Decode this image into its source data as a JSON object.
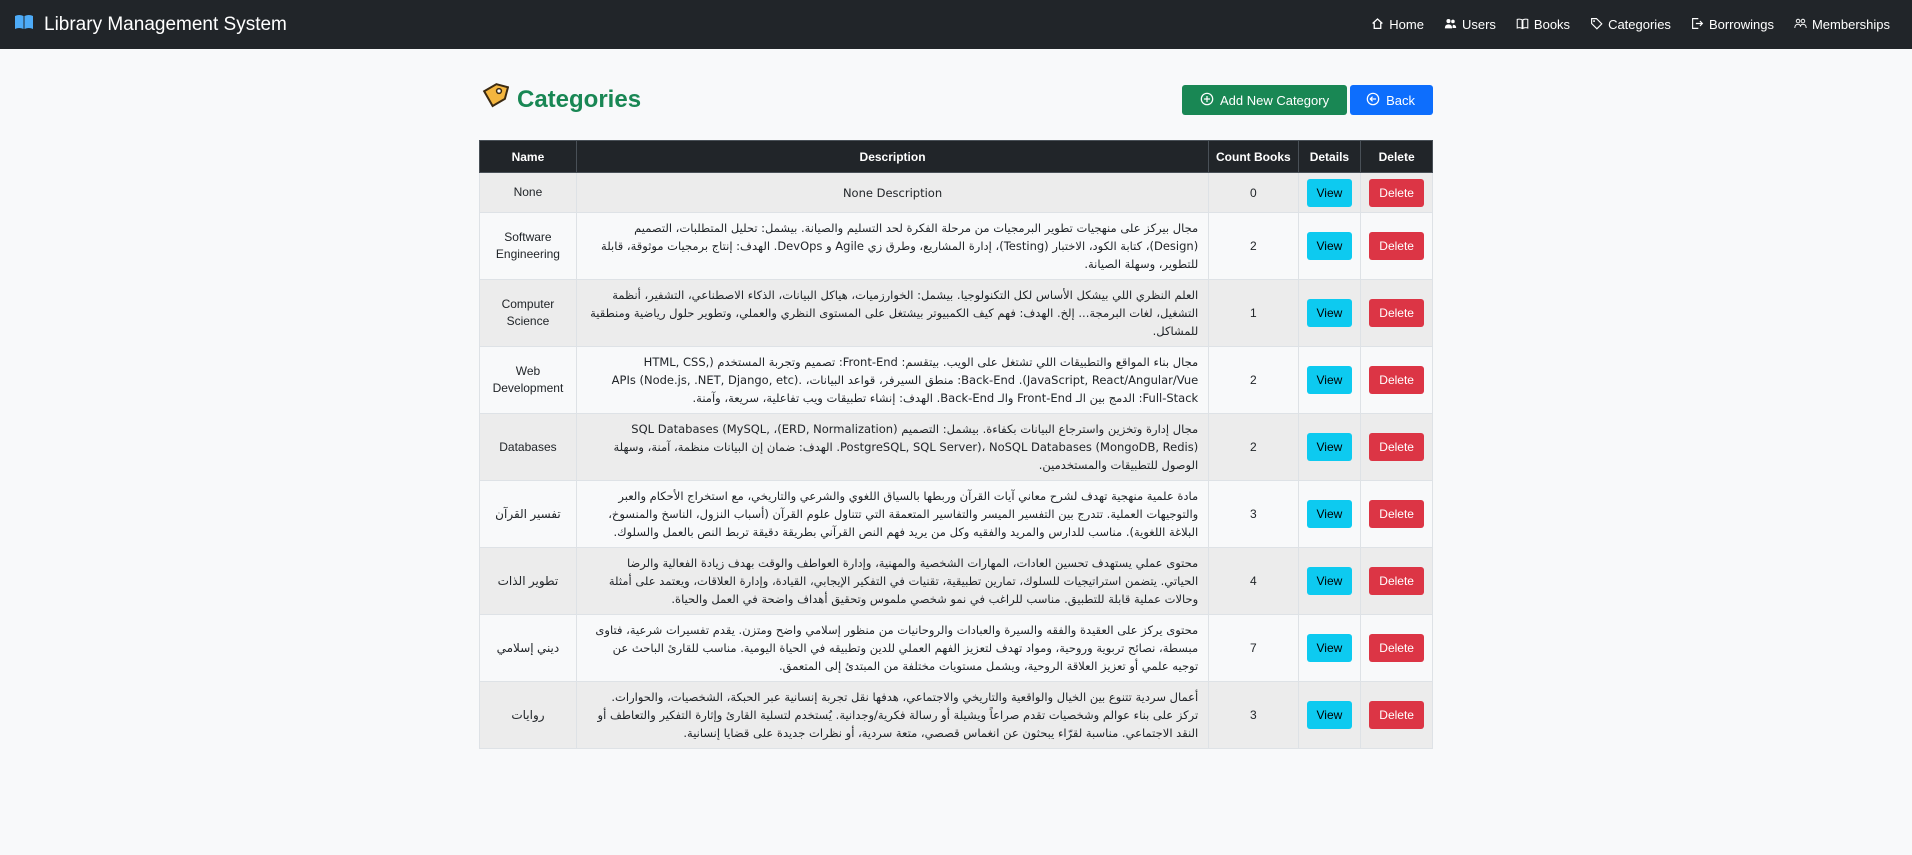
{
  "nav": {
    "brand": "Library Management System",
    "links": [
      {
        "label": "Home",
        "icon": "house-icon"
      },
      {
        "label": "Users",
        "icon": "users-icon"
      },
      {
        "label": "Books",
        "icon": "book-icon"
      },
      {
        "label": "Categories",
        "icon": "tag-icon"
      },
      {
        "label": "Borrowings",
        "icon": "arrow-out-icon"
      },
      {
        "label": "Memberships",
        "icon": "people-icon"
      }
    ]
  },
  "page": {
    "title": "Categories",
    "add_button": "Add New Category",
    "back_button": "Back"
  },
  "table": {
    "headers": [
      "Name",
      "Description",
      "Count Books",
      "Details",
      "Delete"
    ],
    "view_label": "View",
    "delete_label": "Delete",
    "rows": [
      {
        "name": "None",
        "description": "None Description",
        "count": "0",
        "rtl": false
      },
      {
        "name": "Software Engineering",
        "description": "مجال بيركز على منهجيات تطوير البرمجيات من مرحلة الفكرة لحد التسليم والصيانة. بيشمل: تحليل المتطلبات، التصميم (Design)، كتابة الكود، الاختبار (Testing)، إدارة المشاريع، وطرق زي Agile و DevOps. الهدف: إنتاج برمجيات موثوقة، قابلة للتطوير، وسهلة الصيانة.",
        "count": "2",
        "rtl": true
      },
      {
        "name": "Computer Science",
        "description": "العلم النظري اللي بيشكل الأساس لكل التكنولوجيا. بيشمل: الخوارزميات، هياكل البيانات، الذكاء الاصطناعي، التشفير، أنظمة التشغيل، لغات البرمجة... إلخ. الهدف: فهم كيف الكمبيوتر بيشتغل على المستوى النظري والعملي، وتطوير حلول رياضية ومنطقية للمشاكل.",
        "count": "1",
        "rtl": true
      },
      {
        "name": "Web Development",
        "description": "مجال بناء المواقع والتطبيقات اللي تشتغل على الويب. بيتقسم: Front-End: تصميم وتجربة المستخدم (HTML, CSS, JavaScript, React/Angular/Vue). Back-End: منطق السيرفر، قواعد البيانات، APIs (Node.js, .NET, Django, etc). Full-Stack: الدمج بين الـ Front-End والـ Back-End. الهدف: إنشاء تطبيقات ويب تفاعلية، سريعة، وآمنة.",
        "count": "2",
        "rtl": true
      },
      {
        "name": "Databases",
        "description": "مجال إدارة وتخزين واسترجاع البيانات بكفاءة. بيشمل: التصميم (ERD, Normalization)، SQL Databases (MySQL, PostgreSQL, SQL Server)، NoSQL Databases (MongoDB, Redis). الهدف: ضمان إن البيانات منظمة، آمنة، وسهلة الوصول للتطبيقات والمستخدمين.",
        "count": "2",
        "rtl": true
      },
      {
        "name": "تفسير القرآن",
        "description": "مادة علمية منهجية تهدف لشرح معاني آيات القرآن وربطها بالسياق اللغوي والشرعي والتاريخي، مع استخراج الأحكام والعبر والتوجيهات العملية. تتدرج بين التفسير الميسر والتفاسير المتعمقة التي تتناول علوم القرآن (أسباب النزول، الناسخ والمنسوخ، البلاغة اللغوية). مناسب للدارس والمريد والفقيه وكل من يريد فهم النص القرآني بطريقة دقيقة تربط النص بالعمل والسلوك.",
        "count": "3",
        "rtl": true
      },
      {
        "name": "تطوير الذات",
        "description": "محتوى عملي يستهدف تحسين العادات، المهارات الشخصية والمهنية، وإدارة العواطف والوقت بهدف زيادة الفعالية والرضا الحياتي. يتضمن استراتيجيات للسلوك، تمارين تطبيقية، تقنيات في التفكير الإيجابي، القيادة، وإدارة العلاقات، ويعتمد على أمثلة وحالات عملية قابلة للتطبيق. مناسب للراغب في نمو شخصي ملموس وتحقيق أهداف واضحة في العمل والحياة.",
        "count": "4",
        "rtl": true
      },
      {
        "name": "ديني إسلامي",
        "description": "محتوى يركز على العقيدة والفقه والسيرة والعبادات والروحانيات من منظور إسلامي واضح ومتزن. يقدم تفسيرات شرعية، فتاوى مبسطة، نصائح تربوية وروحية، ومواد تهدف لتعزيز الفهم العملي للدين وتطبيقه في الحياة اليومية. مناسب للقارئ الباحث عن توجيه علمي أو تعزيز العلاقة الروحية، ويشمل مستويات مختلفة من المبتدئ إلى المتعمق.",
        "count": "7",
        "rtl": true
      },
      {
        "name": "روايات",
        "description": "أعمال سردية تتنوع بين الخيال والواقعية والتاريخي والاجتماعي، هدفها نقل تجربة إنسانية عبر الحبكة، الشخصيات، والحوارات. تركز على بناء عوالم وشخصيات تقدم صراعاً ويشيلة أو رسالة فكرية/وجدانية. يُستخدم لتسلية القارئ وإثارة التفكير والتعاطف أو النقد الاجتماعي. مناسبة لقرّاء يبحثون عن انغماس قصصي، متعة سردية، أو نظرات جديدة على قضايا إنسانية.",
        "count": "3",
        "rtl": true
      }
    ]
  }
}
